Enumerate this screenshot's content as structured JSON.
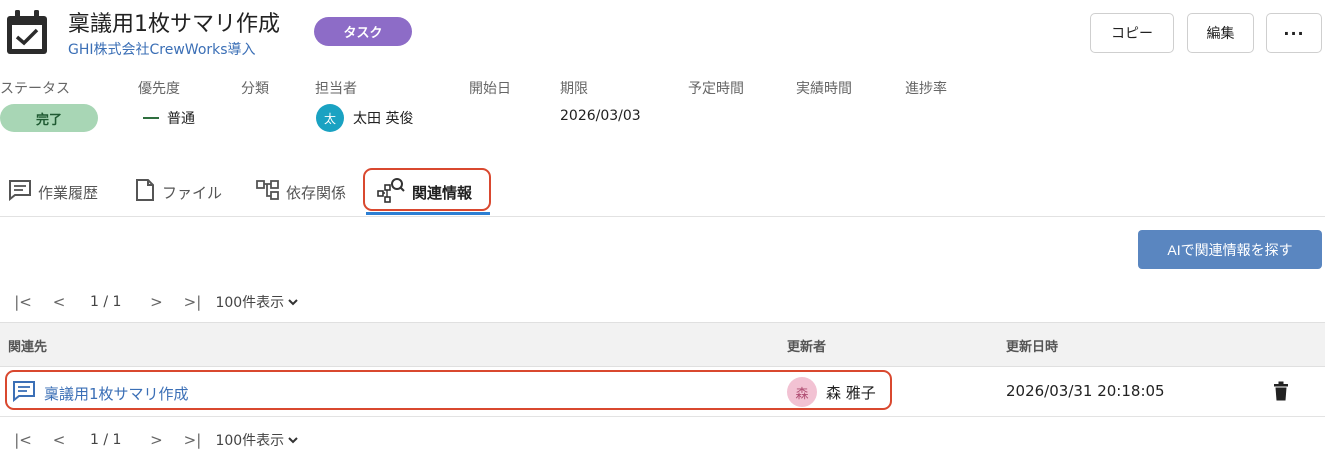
{
  "header": {
    "title": "稟議用1枚サマリ作成",
    "subtitle": "GHI株式会社CrewWorks導入",
    "type_badge": "タスク",
    "copy_label": "コピー",
    "edit_label": "編集",
    "more_label": "···",
    "icon": "calendar-check-icon"
  },
  "properties": {
    "labels": {
      "status": "ステータス",
      "priority": "優先度",
      "category": "分類",
      "assignee": "担当者",
      "start_date": "開始日",
      "due_date": "期限",
      "planned_time": "予定時間",
      "actual_time": "実績時間",
      "progress": "進捗率"
    },
    "status": "完了",
    "priority": "普通",
    "assignee_initial": "太",
    "assignee": "太田 英俊",
    "due_date": "2026/03/03"
  },
  "tabs": [
    {
      "label": "作業履歴",
      "icon": "comment-lines-icon"
    },
    {
      "label": "ファイル",
      "icon": "file-icon"
    },
    {
      "label": "依存関係",
      "icon": "dependency-icon"
    },
    {
      "label": "関連情報",
      "icon": "related-search-icon",
      "active": true
    }
  ],
  "ai_button_label": "AIで関連情報を探す",
  "pager": {
    "first": "|<",
    "prev": "<",
    "next": ">",
    "last": ">|",
    "page_info": "1 / 1",
    "per_page": "100件表示"
  },
  "table": {
    "columns": [
      "関連先",
      "更新者",
      "更新日時"
    ],
    "rows": [
      {
        "related": "稟議用1枚サマリ作成",
        "updater_initial": "森",
        "updater": "森 雅子",
        "updated_at": "2026/03/31 20:18:05"
      }
    ]
  },
  "colors": {
    "accent": "#2d7fd3",
    "badge": "#8d6cc7",
    "status_done": "#a8d6b5",
    "ai_button": "#5a86c0",
    "highlight": "#d9482f"
  }
}
